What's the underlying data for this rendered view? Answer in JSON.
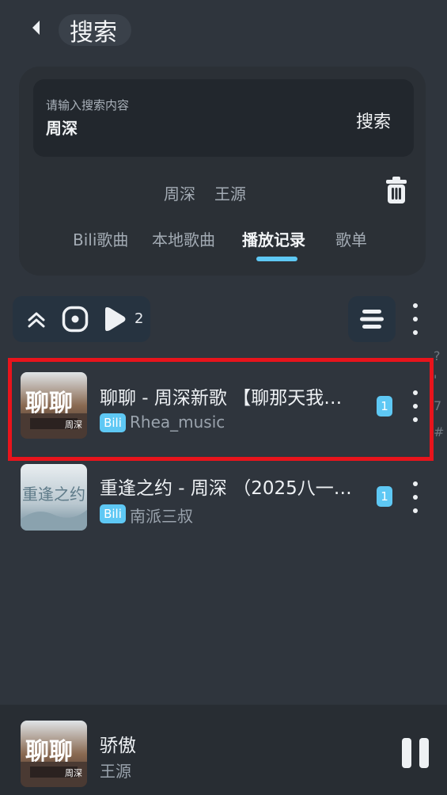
{
  "header": {
    "back_icon": "chevron-left-icon",
    "title": "搜索"
  },
  "search": {
    "placeholder": "请输入搜索内容",
    "value": "周深",
    "button_label": "搜索"
  },
  "history": {
    "items": [
      "周深",
      "王源"
    ],
    "clear_icon": "trash-icon"
  },
  "tabs": [
    {
      "label": "Bili歌曲",
      "active": false
    },
    {
      "label": "本地歌曲",
      "active": false
    },
    {
      "label": "播放记录",
      "active": true
    },
    {
      "label": "歌单",
      "active": false
    }
  ],
  "toolbar": {
    "collapse_icon": "double-chevron-up-icon",
    "locate_icon": "target-icon",
    "play_icon": "play-icon",
    "play_count": "2",
    "list_icon": "list-icon",
    "more_icon": "more-vertical-icon"
  },
  "songs": [
    {
      "title": "聊聊 - 周深新歌 【聊那天我…",
      "source": "Bili",
      "uploader": "Rhea_music",
      "count": "1",
      "cover_text": "聊聊",
      "cover_sub": "周深",
      "selected": true
    },
    {
      "title": "重逢之约 - 周深 （2025八一…",
      "source": "Bili",
      "uploader": "南派三叔",
      "count": "1",
      "cover_text": "重逢之约",
      "cover_sub": "",
      "selected": false
    }
  ],
  "edge_glyphs": [
    "?",
    "'",
    "7",
    "#"
  ],
  "player": {
    "title": "骄傲",
    "artist": "王源",
    "cover_text": "聊聊",
    "cover_sub": "周深",
    "pause_icon": "pause-icon"
  },
  "colors": {
    "accent": "#5ec8f4",
    "background": "#2f353d",
    "highlight": "#e8141c"
  }
}
